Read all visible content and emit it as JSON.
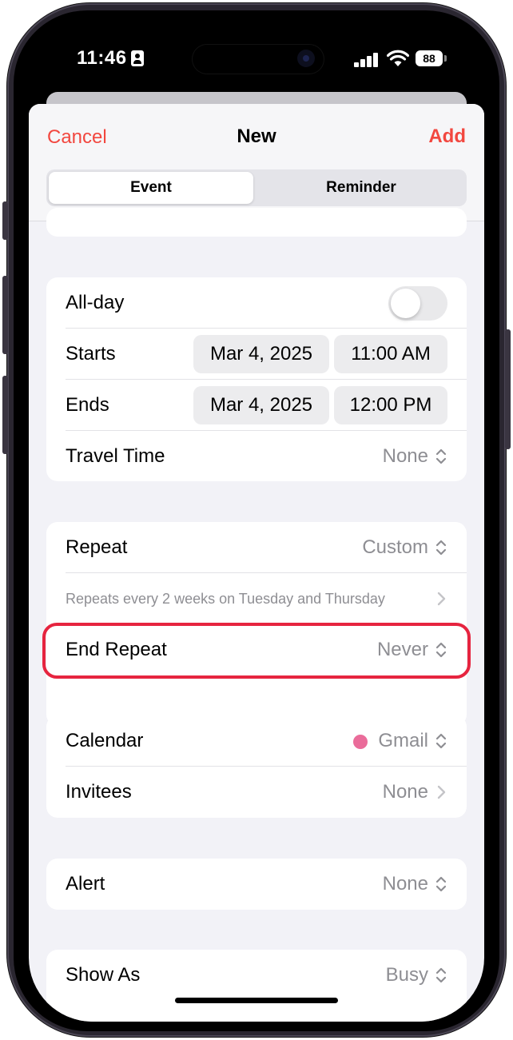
{
  "status_bar": {
    "time": "11:46",
    "battery": "88"
  },
  "nav": {
    "cancel": "Cancel",
    "title": "New",
    "add": "Add"
  },
  "segments": {
    "event": "Event",
    "reminder": "Reminder"
  },
  "datetime": {
    "allday_label": "All-day",
    "allday_on": false,
    "starts_label": "Starts",
    "starts_date": "Mar 4, 2025",
    "starts_time": "11:00 AM",
    "ends_label": "Ends",
    "ends_date": "Mar 4, 2025",
    "ends_time": "12:00 PM",
    "travel_label": "Travel Time",
    "travel_value": "None"
  },
  "repeat": {
    "label": "Repeat",
    "value": "Custom",
    "description": "Repeats every 2 weeks on Tuesday and Thursday",
    "end_label": "End Repeat",
    "end_value": "Never"
  },
  "calendar": {
    "label": "Calendar",
    "value": "Gmail",
    "color": "#ea6c9a",
    "invitees_label": "Invitees",
    "invitees_value": "None"
  },
  "alert": {
    "label": "Alert",
    "value": "None"
  },
  "showas": {
    "label": "Show As",
    "value": "Busy"
  },
  "colors": {
    "accent": "#f2473f",
    "highlight": "#e6243f"
  }
}
